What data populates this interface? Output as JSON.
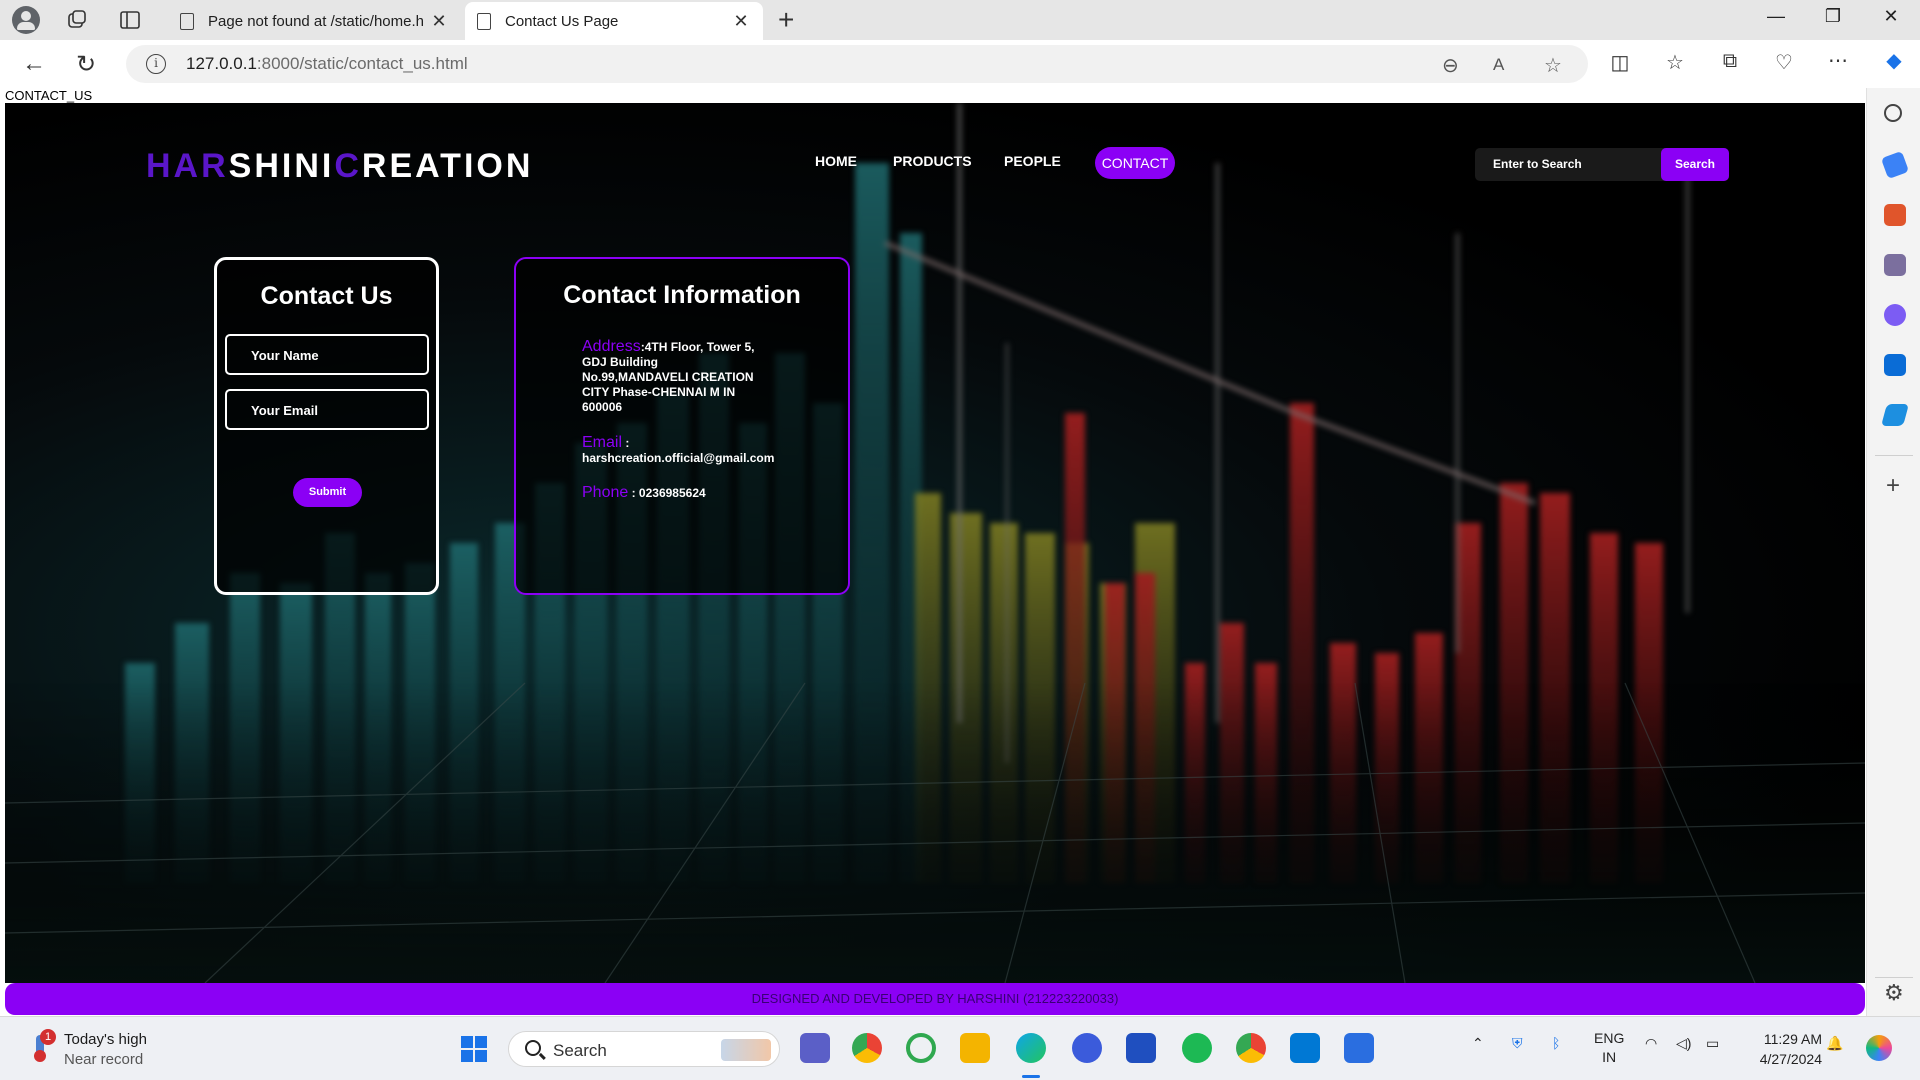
{
  "browser": {
    "tabs": [
      {
        "title": "Page not found at /static/home.h",
        "active": false
      },
      {
        "title": "Contact Us Page",
        "active": true
      }
    ],
    "url_host": "127.0.0.1",
    "url_path": ":8000/static/contact_us.html"
  },
  "page": {
    "document_title": "CONTACT_US",
    "logo": {
      "part1": "HAR",
      "part2": "SHINI",
      "part3": "C",
      "part4": "REATION"
    },
    "nav": [
      {
        "label": "HOME"
      },
      {
        "label": "PRODUCTS"
      },
      {
        "label": "PEOPLE"
      },
      {
        "label": "CONTACT",
        "active": true
      }
    ],
    "search": {
      "placeholder": "Enter to Search",
      "button": "Search"
    },
    "contact_form": {
      "title": "Contact Us",
      "name_placeholder": "Your Name",
      "email_placeholder": "Your Email",
      "submit": "Submit"
    },
    "contact_info": {
      "title": "Contact Information",
      "address_label": "Address",
      "address_value": ":4TH Floor, Tower 5,",
      "address_lines": [
        "GDJ Building",
        "No.99,MANDAVELI CREATION",
        "CITY Phase-CHENNAI M IN",
        "600006"
      ],
      "email_label": "Email",
      "email_sep": " :",
      "email_value": "harshcreation.official@gmail.com",
      "phone_label": "Phone",
      "phone_value": " : 0236985624"
    },
    "footer": "DESIGNED AND DEVELOPED BY HARSHINI (212223220033)"
  },
  "taskbar": {
    "weather_title": "Today's high",
    "weather_sub": "Near record",
    "weather_badge": "1",
    "search": "Search",
    "lang1": "ENG",
    "lang2": "IN",
    "time": "11:29 AM",
    "date": "4/27/2024"
  },
  "colors": {
    "accent": "#8b00f5",
    "logo_accent": "#5a16c9",
    "background": "#000000"
  }
}
